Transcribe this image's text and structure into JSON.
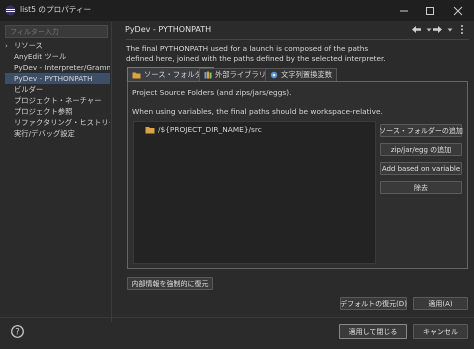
{
  "window": {
    "title": "list5 のプロパティー",
    "minimize_icon": "minimize-icon",
    "maximize_icon": "maximize-icon",
    "close_icon": "close-icon"
  },
  "filter": {
    "placeholder": "フィルター入力"
  },
  "nav": {
    "items": [
      {
        "label": "リソース",
        "expandable": true
      },
      {
        "label": "AnyEdit ツール",
        "expandable": false
      },
      {
        "label": "PyDev - Interpreter/Gramma",
        "expandable": false
      },
      {
        "label": "PyDev - PYTHONPATH",
        "expandable": false,
        "selected": true
      },
      {
        "label": "ビルダー",
        "expandable": false
      },
      {
        "label": "プロジェクト・ネーチャー",
        "expandable": false
      },
      {
        "label": "プロジェクト参照",
        "expandable": false
      },
      {
        "label": "リファクタリング・ヒストリー",
        "expandable": false
      },
      {
        "label": "実行/デバッグ設定",
        "expandable": false
      }
    ]
  },
  "page": {
    "title": "PyDev - PYTHONPATH",
    "description_line1": "The final PYTHONPATH used for a launch is composed of the paths",
    "description_line2": "defined here, joined with the paths defined by the selected interpreter."
  },
  "tabs": [
    {
      "label": "ソース・フォルダー",
      "icon": "source-folder-icon",
      "active": true
    },
    {
      "label": "外部ライブラリー",
      "icon": "library-icon",
      "active": false
    },
    {
      "label": "文字列置換変数",
      "icon": "variable-icon",
      "active": false
    }
  ],
  "source_tab": {
    "heading": "Project Source Folders (and zips/jars/eggs).",
    "note": "When using variables, the final paths should be workspace-relative.",
    "tree_items": [
      "/${PROJECT_DIR_NAME}/src"
    ],
    "buttons": {
      "add_source_folder": "ソース・フォルダーの追加",
      "add_zip": "zip/jar/egg の追加",
      "add_variable": "Add based on variable",
      "remove": "除去"
    }
  },
  "force_restore_button": "内部情報を強制的に復元",
  "footer": {
    "restore_defaults": "デフォルトの復元(D)",
    "apply": "適用(A)",
    "apply_and_close": "適用して閉じる",
    "cancel": "キャンセル"
  },
  "colors": {
    "background": "#2b2b2b",
    "selection": "#3d4f66",
    "folder": "#d9a441"
  }
}
